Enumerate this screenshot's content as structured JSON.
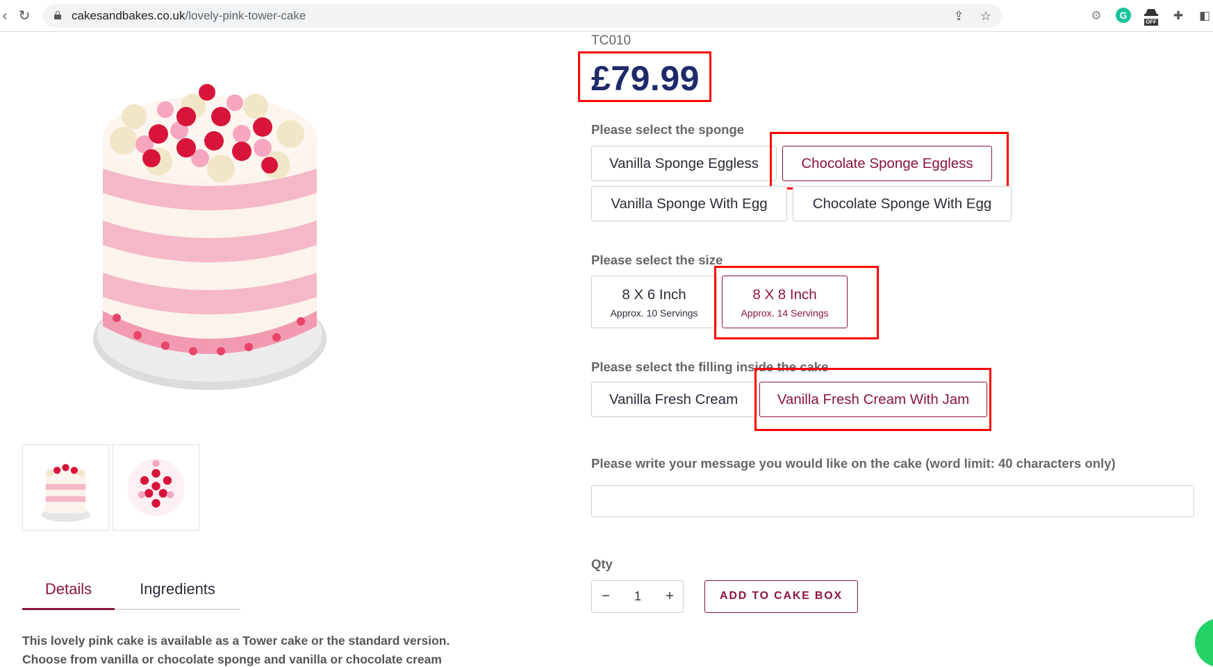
{
  "browser": {
    "url_domain": "cakesandbakes.co.uk",
    "url_path": "/lovely-pink-tower-cake",
    "off_badge": "OFF"
  },
  "product": {
    "sku": "TC010",
    "price": "£79.99"
  },
  "sponge": {
    "label": "Please select the sponge",
    "options": [
      {
        "label": "Vanilla Sponge Eggless",
        "selected": false
      },
      {
        "label": "Chocolate Sponge Eggless",
        "selected": true
      },
      {
        "label": "Vanilla Sponge With Egg",
        "selected": false
      },
      {
        "label": "Chocolate Sponge With Egg",
        "selected": false
      }
    ]
  },
  "size": {
    "label": "Please select the size",
    "options": [
      {
        "label": "8 X 6 Inch",
        "sub": "Approx. 10 Servings",
        "selected": false
      },
      {
        "label": "8 X 8 Inch",
        "sub": "Approx. 14 Servings",
        "selected": true
      }
    ]
  },
  "filling": {
    "label": "Please select the filling inside the cake",
    "options": [
      {
        "label": "Vanilla Fresh Cream",
        "selected": false
      },
      {
        "label": "Vanilla Fresh Cream With Jam",
        "selected": true
      }
    ]
  },
  "message": {
    "label": "Please write your message you would like on the cake (word limit: 40 characters only)",
    "value": ""
  },
  "quantity": {
    "label": "Qty",
    "value": "1",
    "minus": "−",
    "plus": "+"
  },
  "cart": {
    "add_label": "ADD TO CAKE BOX"
  },
  "tabs": [
    {
      "label": "Details",
      "active": true
    },
    {
      "label": "Ingredients",
      "active": false
    }
  ],
  "description": "This lovely pink cake is available as a Tower cake or the standard version. Choose from vanilla or chocolate sponge and vanilla or chocolate cream",
  "colors": {
    "accent": "#8b1538",
    "price": "#1e2a6b",
    "highlight": "#ff0000"
  }
}
